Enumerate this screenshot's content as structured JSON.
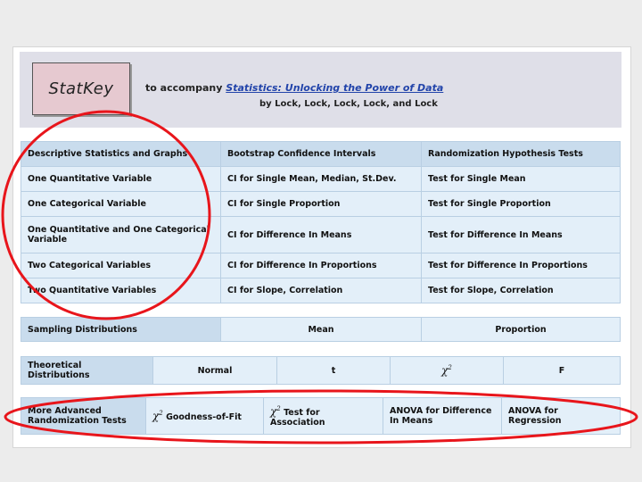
{
  "header": {
    "logo": "StatKey",
    "line1_prefix": "to accompany ",
    "book_title": "Statistics: Unlocking the Power of Data",
    "byline": "by Lock, Lock, Lock, Lock, and Lock"
  },
  "columns": {
    "descriptive": "Descriptive Statistics and Graphs",
    "bootstrap": "Bootstrap Confidence Intervals",
    "randomization": "Randomization Hypothesis Tests"
  },
  "rows": [
    {
      "desc": "One Quantitative Variable",
      "ci": "CI for Single Mean, Median, St.Dev.",
      "test": "Test for Single Mean"
    },
    {
      "desc": "One Categorical Variable",
      "ci": "CI for Single Proportion",
      "test": "Test for Single Proportion"
    },
    {
      "desc": "One Quantitative and One Categorical Variable",
      "ci": "CI for Difference In Means",
      "test": "Test for Difference In Means"
    },
    {
      "desc": "Two Categorical Variables",
      "ci": "CI for Difference In Proportions",
      "test": "Test for Difference In Proportions"
    },
    {
      "desc": "Two Quantitative Variables",
      "ci": "CI for Slope, Correlation",
      "test": "Test for Slope, Correlation"
    }
  ],
  "sampling": {
    "label": "Sampling Distributions",
    "mean": "Mean",
    "proportion": "Proportion"
  },
  "theoretical": {
    "label": "Theoretical Distributions",
    "normal": "Normal",
    "t": "t",
    "chi": "χ",
    "chi_sup": "2",
    "f": "F"
  },
  "advanced": {
    "label": "More Advanced Randomization Tests",
    "gof": "Goodness-of-Fit",
    "assoc": "Test for Association",
    "anova_means": "ANOVA for Difference In Means",
    "anova_reg": "ANOVA for Regression"
  },
  "colors": {
    "annotation": "#e8151b",
    "cell": "#e3eff9",
    "header_cell": "#c9dced"
  }
}
